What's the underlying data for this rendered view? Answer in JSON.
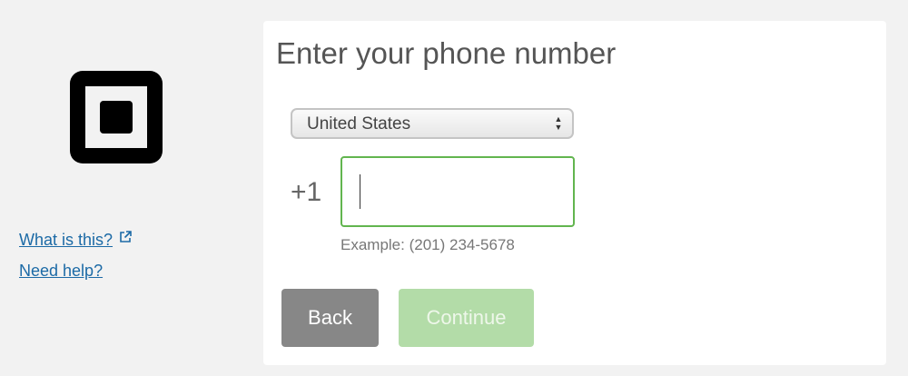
{
  "sidebar": {
    "logo_icon": "square-logo-icon",
    "what_is_this_label": "What is this?",
    "need_help_label": "Need help?",
    "external_link_icon": "external-link-icon"
  },
  "form": {
    "title": "Enter your phone number",
    "country_select": {
      "selected": "United States",
      "icon": "select-arrows-icon"
    },
    "country_code": "+1",
    "phone_input": {
      "value": "",
      "focused": true
    },
    "example": "Example: (201) 234-5678"
  },
  "buttons": {
    "back_label": "Back",
    "continue_label": "Continue",
    "continue_disabled": true
  },
  "colors": {
    "link": "#1c6aa6",
    "focus_border": "#62b54f",
    "back_button": "#878787",
    "continue_button_disabled": "#b3dca8",
    "page_background": "#f2f2f2"
  }
}
